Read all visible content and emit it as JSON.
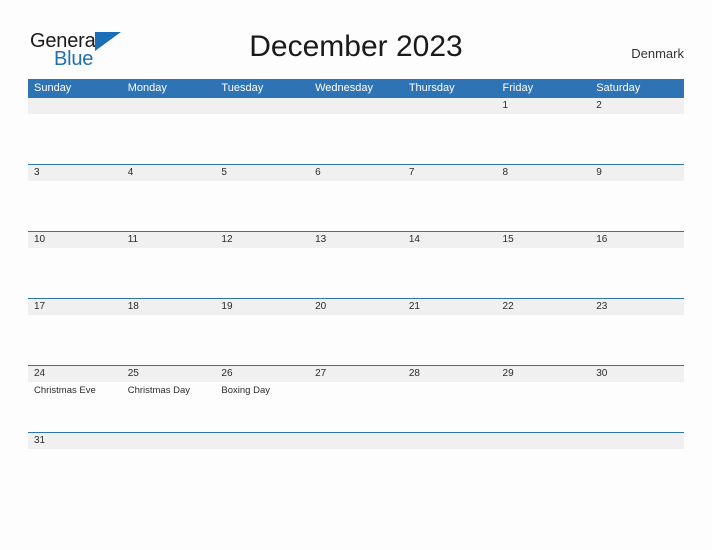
{
  "brand": {
    "logo_general": "General",
    "logo_blue": "Blue",
    "logo_flag_icon": "flag-triangle-icon"
  },
  "header": {
    "title": "December 2023",
    "country": "Denmark"
  },
  "calendar": {
    "month": "December",
    "year": "2023",
    "weekday_headers": [
      "Sunday",
      "Monday",
      "Tuesday",
      "Wednesday",
      "Thursday",
      "Friday",
      "Saturday"
    ],
    "colors": {
      "header_blue": "#2E73B4",
      "row_band_grey": "#F0F0F0",
      "logo_blue": "#1F6FB5",
      "text": "#2B2B2B",
      "page_background": "#FDFDFD"
    },
    "weeks": [
      [
        {
          "date": "",
          "event": ""
        },
        {
          "date": "",
          "event": ""
        },
        {
          "date": "",
          "event": ""
        },
        {
          "date": "",
          "event": ""
        },
        {
          "date": "",
          "event": ""
        },
        {
          "date": "1",
          "event": ""
        },
        {
          "date": "2",
          "event": ""
        }
      ],
      [
        {
          "date": "3",
          "event": ""
        },
        {
          "date": "4",
          "event": ""
        },
        {
          "date": "5",
          "event": ""
        },
        {
          "date": "6",
          "event": ""
        },
        {
          "date": "7",
          "event": ""
        },
        {
          "date": "8",
          "event": ""
        },
        {
          "date": "9",
          "event": ""
        }
      ],
      [
        {
          "date": "10",
          "event": ""
        },
        {
          "date": "11",
          "event": ""
        },
        {
          "date": "12",
          "event": ""
        },
        {
          "date": "13",
          "event": ""
        },
        {
          "date": "14",
          "event": ""
        },
        {
          "date": "15",
          "event": ""
        },
        {
          "date": "16",
          "event": ""
        }
      ],
      [
        {
          "date": "17",
          "event": ""
        },
        {
          "date": "18",
          "event": ""
        },
        {
          "date": "19",
          "event": ""
        },
        {
          "date": "20",
          "event": ""
        },
        {
          "date": "21",
          "event": ""
        },
        {
          "date": "22",
          "event": ""
        },
        {
          "date": "23",
          "event": ""
        }
      ],
      [
        {
          "date": "24",
          "event": "Christmas Eve"
        },
        {
          "date": "25",
          "event": "Christmas Day"
        },
        {
          "date": "26",
          "event": "Boxing Day"
        },
        {
          "date": "27",
          "event": ""
        },
        {
          "date": "28",
          "event": ""
        },
        {
          "date": "29",
          "event": ""
        },
        {
          "date": "30",
          "event": ""
        }
      ],
      [
        {
          "date": "31",
          "event": ""
        },
        {
          "date": "",
          "event": ""
        },
        {
          "date": "",
          "event": ""
        },
        {
          "date": "",
          "event": ""
        },
        {
          "date": "",
          "event": ""
        },
        {
          "date": "",
          "event": ""
        },
        {
          "date": "",
          "event": ""
        }
      ]
    ]
  }
}
